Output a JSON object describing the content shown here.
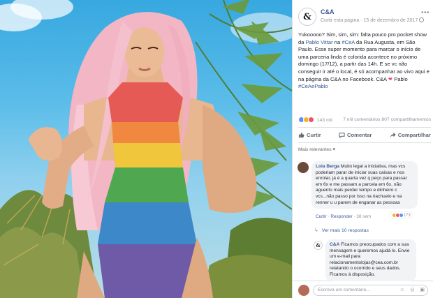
{
  "post": {
    "page_name": "C&A",
    "avatar_glyph": "&",
    "meta_link": "Curtir esta página",
    "meta_sep": " · ",
    "date": "15 de dezembro de 2017",
    "menu_glyph": "•••",
    "text": {
      "part1": "Yukooooo? Sim, sim, sim: falta pouco pro pocket show da ",
      "mention": "Pablo Vittar",
      "part2": " na ",
      "hashtag1": "#CeA",
      "part3": " da Rua Augusta, em São Paulo. Esse super momento para marcar o início de uma parceria linda é colorida acontece no próximo domingo (17/12), a partir das 14h. E se vc não conseguir ir até o local, é só acompanhar ao vivo aqui e na página da C&A no Facebook. C&A ",
      "heart": "❤",
      "part4": " Pablo ",
      "hashtag2": "#CeAePablo"
    },
    "reactions": {
      "count": "143 mil",
      "comments": "7 mil comentários",
      "shares": "807 compartilhamentos",
      "types": [
        "like",
        "wow",
        "love"
      ]
    },
    "actions": [
      {
        "label": "Curtir",
        "icon": "thumbs-up-icon"
      },
      {
        "label": "Comentar",
        "icon": "comment-icon"
      },
      {
        "label": "Compartilhar",
        "icon": "share-icon"
      }
    ],
    "sort_label": "Mais relevantes ▾"
  },
  "comments": [
    {
      "author": "Lola Berga",
      "text": " Muito legal a iniciativa, mas vcs poderiam parar de iniciar suas caixas e nos enrolar, já é a quarta vez q peço para passar em 6x e me passam a parcela em 6x, não aguento mais perder tempo e dinheiro c vcs...não passo por isso na riachuelo e na renner u u parem de enganar as pessoas",
      "like_link": "Curtir",
      "reply_link": "Responder",
      "time": "38 sem",
      "reaction_count": "173",
      "avatar_color": "#6b4a3a"
    },
    {
      "author": "C&A",
      "text": " Ficamos preocupados com a sua mensagem e queremos ajudá lo. Envie um e-mail para relacionamentolojas@cea.com.br relatando o ocorrido e seus dados. Ficamos à disposição.",
      "avatar_color": "#ffffff"
    }
  ],
  "more_replies": "Ver mais 10 respostas",
  "reply_placeholder": "Escreva um comentário...",
  "reply_icons": "☺ ◎ ▣",
  "colors": {
    "link": "#385898",
    "meta": "#90949c",
    "bubble": "#f2f3f5",
    "heart": "#e94e77",
    "like": "#5890ff",
    "wow": "#f7b125",
    "love": "#f25268"
  }
}
